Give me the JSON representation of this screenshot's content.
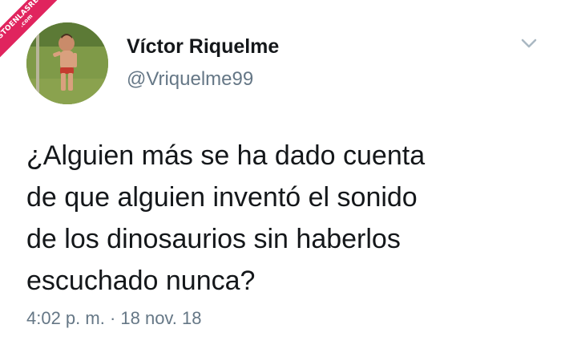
{
  "watermark": {
    "line1": "VISTOENLASREDES",
    "line2": ".com"
  },
  "user": {
    "display_name": "Víctor Riquelme",
    "handle": "@Vriquelme99",
    "avatar_icon": "avatar-photo"
  },
  "tweet": {
    "lines": [
      "¿Alguien más se ha dado cuenta",
      "de que alguien inventó el sonido",
      "de los dinosaurios sin haberlos",
      "escuchado nunca?"
    ],
    "timestamp": "4:02 p. m. · 18 nov. 18"
  },
  "menu": {
    "icon": "chevron-down-icon"
  },
  "colors": {
    "text": "#14171a",
    "secondary": "#657786",
    "watermark": "#e0245e",
    "chevron": "#aab8c2"
  }
}
